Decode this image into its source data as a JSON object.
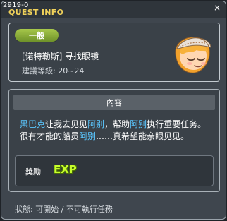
{
  "window": {
    "id_text": "2919-0",
    "title": "QUEST INFO",
    "close_glyph": "×"
  },
  "quest": {
    "category_badge": "一般",
    "name": "[诺特勒斯] 寻找眼镜",
    "recommended_level": "建議等級: 20~24"
  },
  "content": {
    "header": "內容",
    "line1": {
      "p1": "黑巴克",
      "p2": "让我去见见",
      "p3": "阿别",
      "p4": "，帮助",
      "p5": "阿别",
      "p6": "执行重要任务。"
    },
    "line2": {
      "p1": "很有才能的船员",
      "p2": "阿别",
      "p3": "……真希望能亲眼见见。"
    }
  },
  "reward": {
    "label": "獎勵",
    "exp_text": "EXP"
  },
  "status": {
    "text": "狀態: 可開始 / 不可執行任務"
  },
  "colors": {
    "accent_gold": "#f1d25a",
    "highlight_blue": "#5bc7ff",
    "badge_green": "#8cae3c",
    "exp_green": "#c7ff2b"
  },
  "icons": {
    "npc": "npc-portrait",
    "exp": "exp-icon"
  }
}
